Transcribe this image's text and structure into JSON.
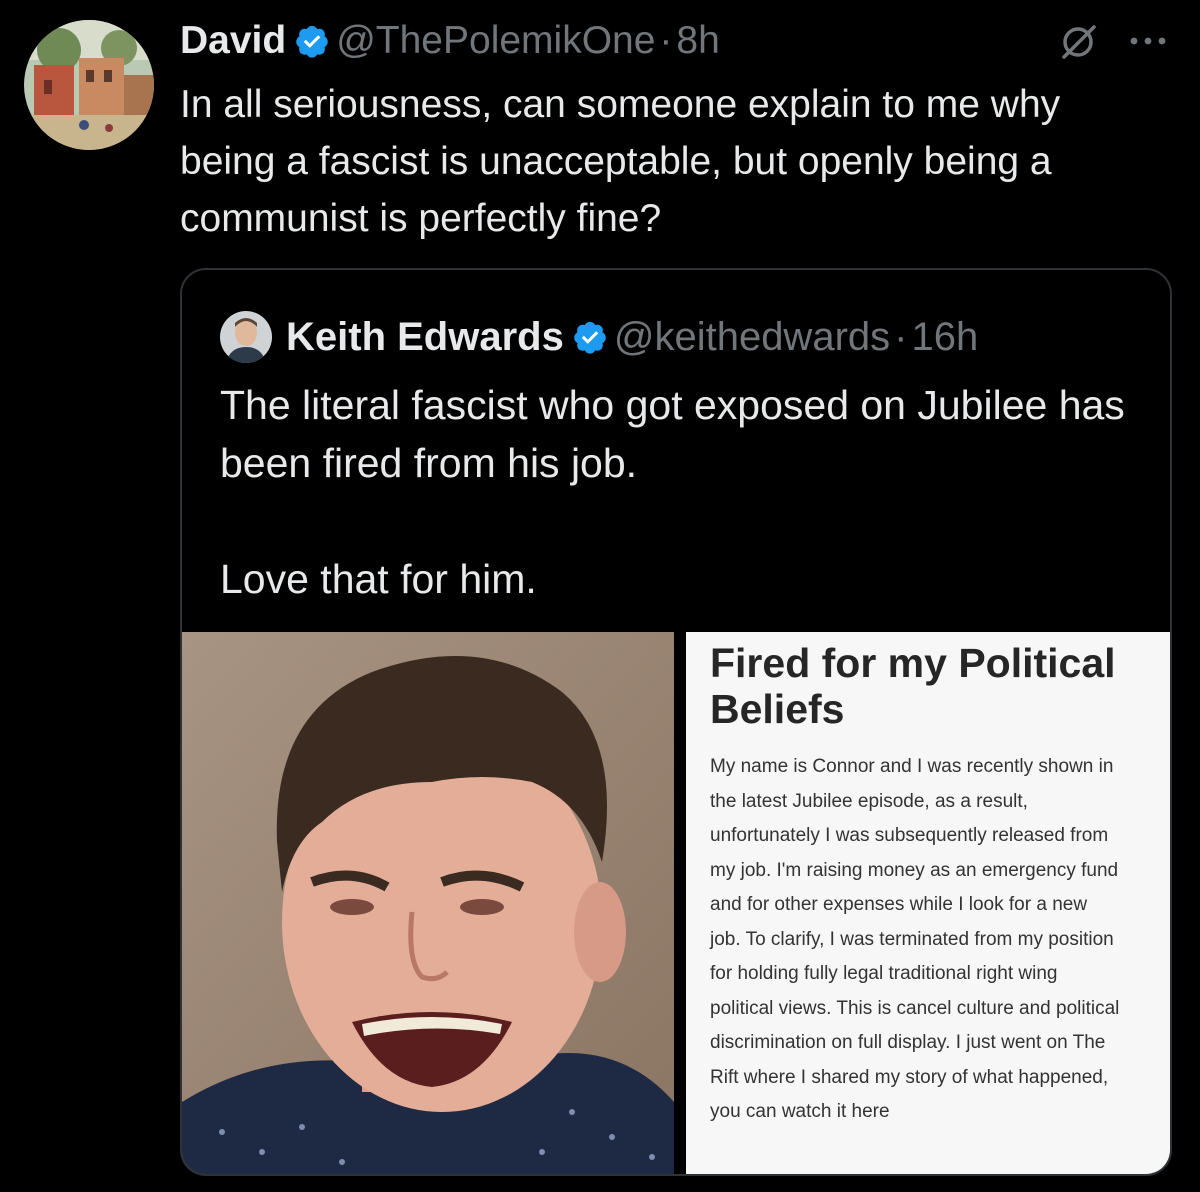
{
  "tweet": {
    "author_name": "David",
    "author_handle": "@ThePolemikOne",
    "separator": "·",
    "time": "8h",
    "text": "In all seriousness, can someone explain to me why being a fascist is unacceptable, but openly being a communist is perfectly fine?",
    "icons": {
      "avatar": "avatar-painting",
      "verified": "verified-badge-icon",
      "grok": "grok-icon",
      "more": "more-options-icon"
    }
  },
  "quote": {
    "author_name": "Keith Edwards",
    "author_handle": "@keithedwards",
    "separator": "·",
    "time": "16h",
    "text_line1": "The literal fascist who got exposed on Jubilee has been fired from his job.",
    "text_line2": "Love that for him."
  },
  "article": {
    "title": "Fired for my Political Beliefs",
    "body": "My name is Connor and I was recently shown in the latest Jubilee episode, as a result, unfortunately I was subsequently released from my job. I'm raising money as an emergency fund and for other expenses while I look for a new job. To clarify, I was terminated from my position for holding fully legal traditional right wing political views. This is cancel culture and political discrimination on full display. I just went on The Rift where I shared my story of what happened, you can watch it here"
  },
  "colors": {
    "background": "#000000",
    "text": "#e7e9ea",
    "secondary": "#71767b",
    "verified": "#1d9bf0",
    "border": "#2f3336"
  }
}
